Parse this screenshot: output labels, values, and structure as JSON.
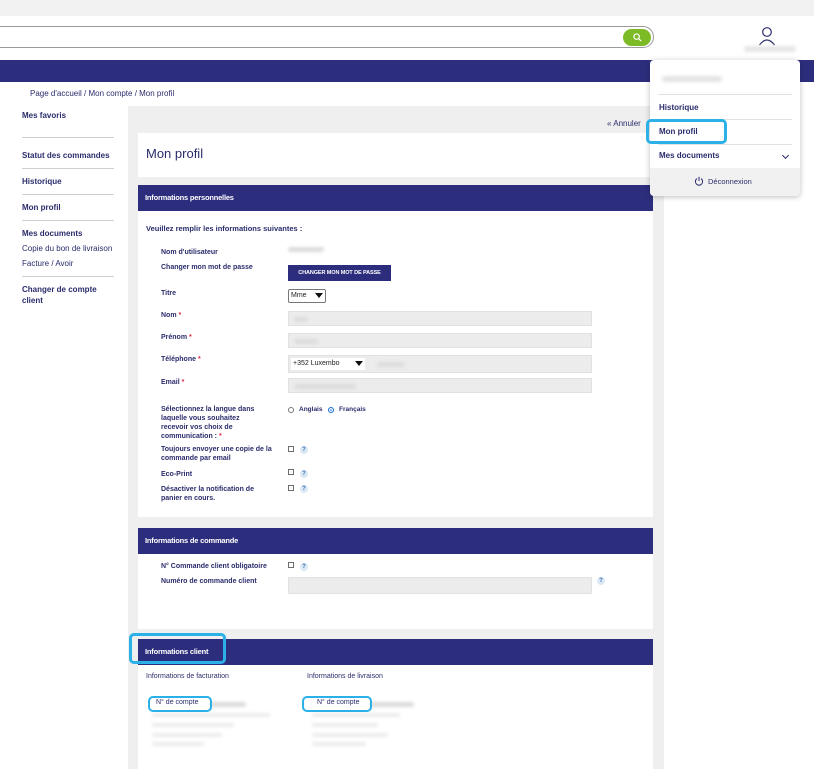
{
  "header": {
    "search": {
      "value": "",
      "placeholder": ""
    },
    "user_name": ""
  },
  "breadcrumb": {
    "text": "Page d'accueil / Mon compte / Mon profil"
  },
  "sidebar": {
    "favorites": "Mes favoris",
    "order_status": "Statut des commandes",
    "history": "Historique",
    "my_profile": "Mon profil",
    "my_documents": "Mes documents",
    "delivery_copy": "Copie du bon de livraison",
    "invoice": "Facture / Avoir",
    "change_account": "Changer de compte client"
  },
  "main": {
    "cancel_link": "« Annuler",
    "page_title": "Mon profil"
  },
  "personal_info": {
    "heading": "Informations personnelles",
    "intro": "Veuillez remplir les informations suivantes :",
    "username_label": "Nom d'utilisateur",
    "change_password_label": "Changer mon mot de passe",
    "change_password_button": "CHANGER MON MOT DE PASSE",
    "title_label": "Titre",
    "title_value": "Mme",
    "lastname_label": "Nom",
    "firstname_label": "Prénom",
    "phone_label": "Téléphone",
    "phone_country": "+352 Luxembo",
    "email_label": "Email",
    "required_mark": "*",
    "language_label": "Sélectionnez la langue dans laquelle vous souhaitez recevoir vos choix de communication :",
    "language_options": [
      "Anglais",
      "Français"
    ],
    "language_selected": "Français",
    "copy_email_label": "Toujours envoyer une copie de la commande par email",
    "eco_print_label": "Eco-Print",
    "disable_cart_label": "Désactiver la notification de panier en cours.",
    "help_glyph": "?"
  },
  "order_info": {
    "heading": "Informations de commande",
    "client_order_required_label": "N° Commande client obligatoire",
    "client_order_number_label": "Numéro de commande client"
  },
  "client_info": {
    "heading": "Informations client",
    "billing_heading": "Informations de facturation",
    "delivery_heading": "Informations de livraison",
    "account_number_label": "N° de compte"
  },
  "user_menu": {
    "history": "Historique",
    "my_profile": "Mon profil",
    "my_documents": "Mes documents",
    "logout": "Déconnexion"
  },
  "colors": {
    "brand_navy": "#2d2d7d",
    "search_green": "#7dbb26",
    "highlight_cyan": "#2bb1e8",
    "required_red": "#e0294a"
  },
  "icons": [
    "search-icon",
    "user-icon",
    "chevron-down-icon",
    "power-icon",
    "help-icon"
  ]
}
